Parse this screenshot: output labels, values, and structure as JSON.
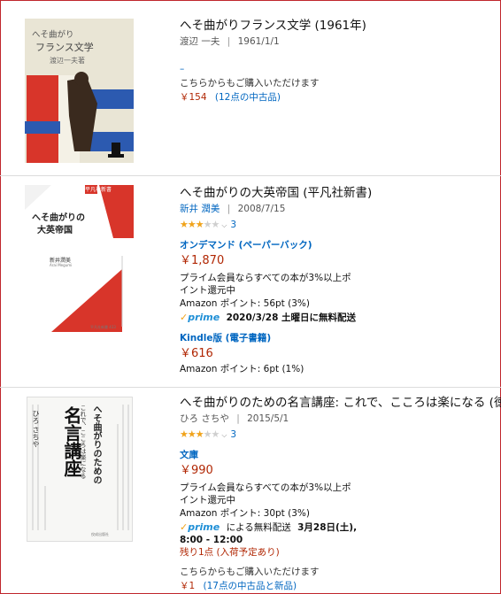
{
  "colors": {
    "link": "#0066c0",
    "price": "#b12704",
    "star": "#f0a31b",
    "prime": "#1f8fd6",
    "border": "#c0262c"
  },
  "items": [
    {
      "cover_lines": [
        "へそ曲がり",
        "フランス文学",
        "渡辺一夫著"
      ],
      "title": "へそ曲がりフランス文学 (1961年)",
      "author": "渡辺 一夫",
      "date": "1961/1/1",
      "dash": "–",
      "other_buy": "こちらからもご購入いただけます",
      "used_price": "￥154",
      "used_text": "(12点の中古品)"
    },
    {
      "cover_lines": [
        "平凡社新書",
        "へそ曲がりの",
        "大英帝国",
        "新井潤美",
        "Arai Megumi",
        "平凡社新書 433"
      ],
      "title": "へそ曲がりの大英帝国 (平凡社新書)",
      "author": "新井 潤美",
      "date": "2008/7/15",
      "rating": 3,
      "review_count": "3",
      "format1": "オンデマンド (ペーパーバック)",
      "price1": "￥1,870",
      "prime_note_1": "プライム会員ならすべての本が3%以上ポ",
      "prime_note_2": "イント還元中",
      "points1": "Amazon ポイント: 56pt (3%)",
      "prime_label": "prime",
      "delivery": "2020/3/28 土曜日に無料配送",
      "format2": "Kindle版 (電子書籍)",
      "price2": "￥616",
      "points2": "Amazon ポイント: 6pt (1%)"
    },
    {
      "cover_lines": [
        "これで、こころは楽になる",
        "へそ曲がりのための",
        "名言講座",
        "ひろ さちや",
        "佼成出版社"
      ],
      "title": "へそ曲がりのための名言講座: これで、こころは楽になる (徳間",
      "author": "ひろ さちや",
      "date": "2015/5/1",
      "rating": 3,
      "review_count": "3",
      "format1": "文庫",
      "price1": "￥990",
      "prime_note_1": "プライム会員ならすべての本が3%以上ポ",
      "prime_note_2": "イント還元中",
      "points1": "Amazon ポイント: 30pt (3%)",
      "prime_label": "prime",
      "delivery_pre": "による無料配送",
      "delivery_date": "3月28日(土),",
      "delivery_time": "8:00 - 12:00",
      "stock": "残り1点 (入荷予定あり)",
      "other_buy": "こちらからもご購入いただけます",
      "used_price": "￥1",
      "used_text": "(17点の中古品と新品)"
    }
  ]
}
